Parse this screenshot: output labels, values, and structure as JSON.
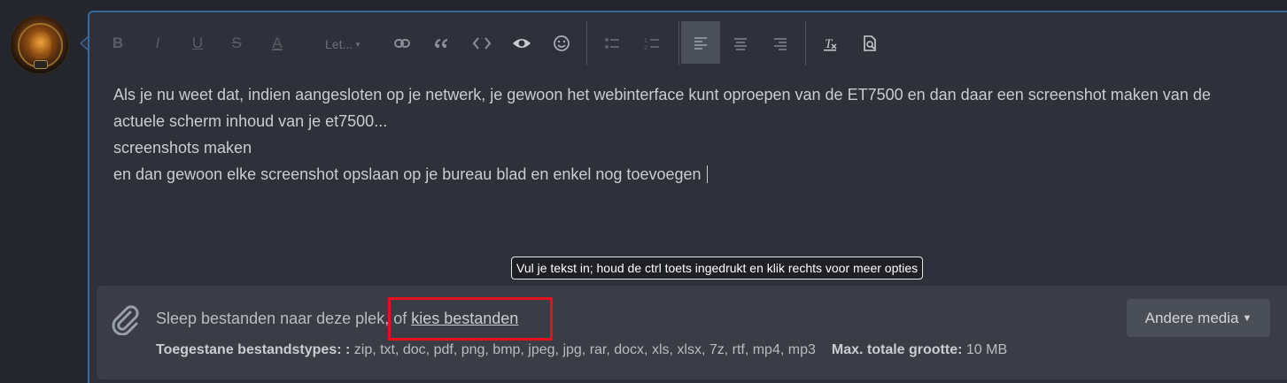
{
  "toolbar": {
    "bold": "B",
    "italic": "I",
    "underline": "U",
    "strike": "S",
    "color": "A",
    "font_select": "Let...",
    "icons": [
      "link-icon",
      "quote-icon",
      "code-icon",
      "spoiler-eye-icon",
      "smiley-icon",
      "bullet-list-icon",
      "numbered-list-icon",
      "align-left-icon",
      "align-center-icon",
      "align-right-icon",
      "clear-format-icon",
      "preview-icon"
    ]
  },
  "content": {
    "lines": [
      "Als je nu weet dat, indien aangesloten op je netwerk, je gewoon het webinterface kunt oproepen van de ET7500 en dan daar een screenshot maken van de",
      "actuele scherm inhoud van je et7500...",
      "screenshots maken",
      "en dan gewoon elke screenshot opslaan op je bureau blad en enkel nog toevoegen"
    ]
  },
  "tooltip": "Vul je tekst in; houd de ctrl toets ingedrukt en klik rechts voor meer opties",
  "attachments": {
    "drop_text": "Sleep bestanden naar deze plek, of ",
    "choose_link": "kies bestanden",
    "types_label": "Toegestane bestandstypes: :",
    "types_value": " zip, txt, doc, pdf, png, bmp, jpeg, jpg, rar, docx, xls, xlsx, 7z, rtf, mp4, mp3",
    "max_label": "Max. totale grootte:",
    "max_value": " 10 MB",
    "other_media": "Andere media"
  },
  "colors": {
    "editor_border": "#3a6a9c",
    "highlight": "#e8101a"
  }
}
